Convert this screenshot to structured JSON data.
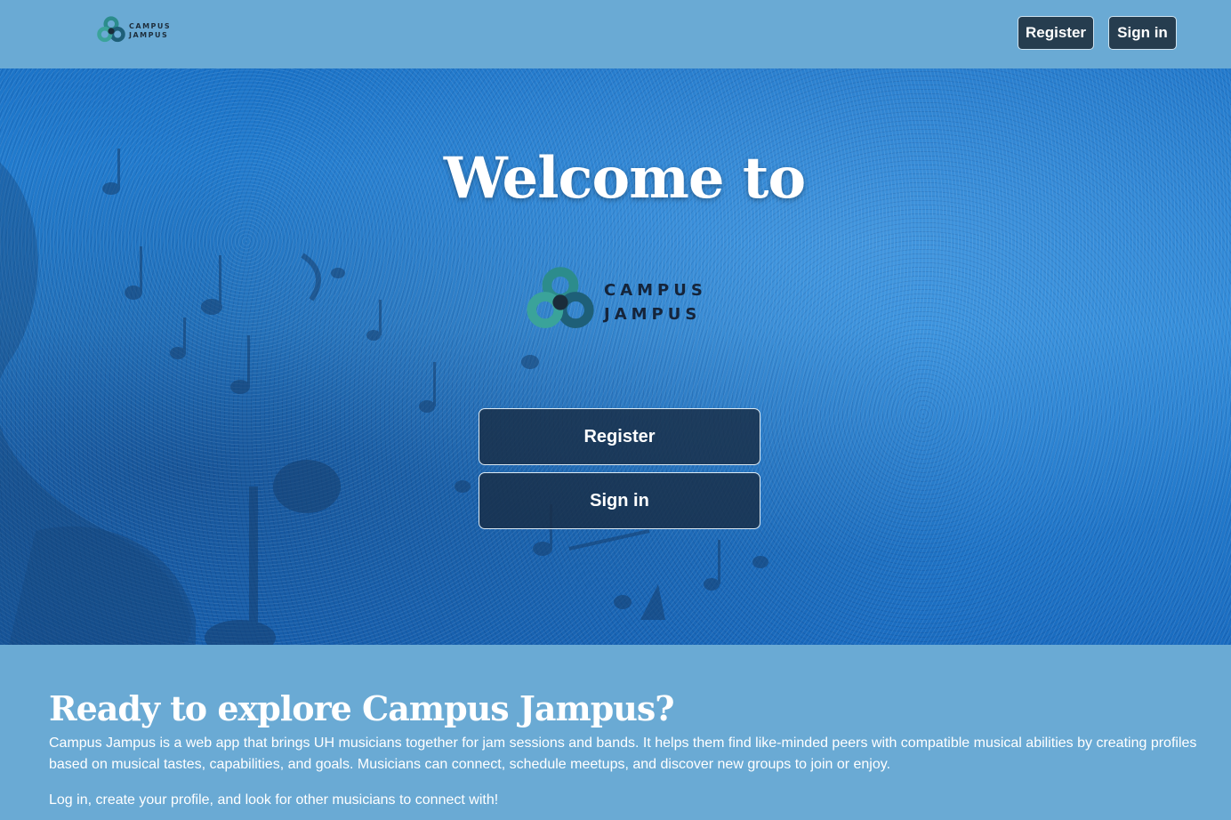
{
  "navbar": {
    "logo_line1": "CAMPUS",
    "logo_line2": "JAMPUS",
    "register_label": "Register",
    "signin_label": "Sign in"
  },
  "hero": {
    "heading": "Welcome to",
    "logo_line1": "CAMPUS",
    "logo_line2": "JAMPUS",
    "register_label": "Register",
    "signin_label": "Sign in"
  },
  "about": {
    "heading": "Ready to explore Campus Jampus?",
    "paragraph1": "Campus Jampus is a web app that brings UH musicians together for jam sessions and bands. It helps them find like-minded peers with compatible musical abilities by creating profiles based on musical tastes, capabilities, and goals. Musicians can connect, schedule meetups, and discover new groups to join or enjoy.",
    "paragraph2": "Log in, create your profile, and look for other musicians to connect with!"
  },
  "colors": {
    "page_bg": "#6aaad4",
    "button_bg": "#263d4f",
    "hero_blue": "#1f78cc"
  },
  "icons": {
    "logo": "campus-jampus-logo-icon",
    "background": "music-notes-icon"
  }
}
